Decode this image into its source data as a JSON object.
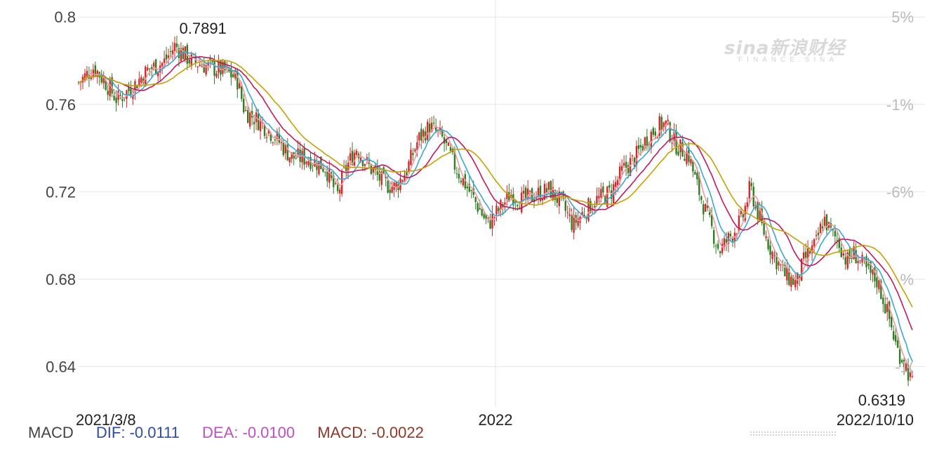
{
  "watermark": {
    "brand": "sina新浪财经",
    "sub": "FINANCE.SINA"
  },
  "indicator_bar": {
    "label": "MACD",
    "dif": "DIF: -0.0111",
    "dea": "DEA: -0.0100",
    "macd": "MACD: -0.0022"
  },
  "colors": {
    "up": "#d62728",
    "down": "#2e7d1e",
    "ma5": "#ee9aa6",
    "ma10": "#3aa6d8",
    "ma20": "#c2185b",
    "ma30": "#c8a000",
    "dif": "#2f4ca0",
    "dea": "#c050c0",
    "macd": "#8b3a2a"
  },
  "chart_data": {
    "type": "candlestick",
    "title": "",
    "ylim": [
      0.628,
      0.802
    ],
    "y_ticks": [
      "0.8",
      "0.76",
      "0.72",
      "0.68",
      "0.64"
    ],
    "y_tick_values": [
      0.8,
      0.76,
      0.72,
      0.68,
      0.64
    ],
    "right_ticks": [
      "5%",
      "-1%",
      "-6%",
      "%",
      "-1("
    ],
    "right_tick_values": [
      0.8,
      0.76,
      0.72,
      0.68,
      0.64
    ],
    "x_labels": [
      "2021/3/8",
      "2022",
      "2022/10/10"
    ],
    "x_label_positions": [
      0,
      0.5,
      1
    ],
    "annotations": {
      "high": "0.7891",
      "low": "0.6319"
    },
    "high": 0.7891,
    "low": 0.6319,
    "price_path": [
      {
        "t": 0.0,
        "v": 0.77
      },
      {
        "t": 0.02,
        "v": 0.777
      },
      {
        "t": 0.035,
        "v": 0.77
      },
      {
        "t": 0.05,
        "v": 0.762
      },
      {
        "t": 0.07,
        "v": 0.768
      },
      {
        "t": 0.09,
        "v": 0.776
      },
      {
        "t": 0.11,
        "v": 0.779
      },
      {
        "t": 0.125,
        "v": 0.787
      },
      {
        "t": 0.145,
        "v": 0.78
      },
      {
        "t": 0.17,
        "v": 0.777
      },
      {
        "t": 0.19,
        "v": 0.775
      },
      {
        "t": 0.205,
        "v": 0.772
      },
      {
        "t": 0.215,
        "v": 0.757
      },
      {
        "t": 0.235,
        "v": 0.752
      },
      {
        "t": 0.255,
        "v": 0.745
      },
      {
        "t": 0.275,
        "v": 0.736
      },
      {
        "t": 0.3,
        "v": 0.735
      },
      {
        "t": 0.32,
        "v": 0.731
      },
      {
        "t": 0.335,
        "v": 0.718
      },
      {
        "t": 0.345,
        "v": 0.73
      },
      {
        "t": 0.36,
        "v": 0.74
      },
      {
        "t": 0.375,
        "v": 0.732
      },
      {
        "t": 0.395,
        "v": 0.724
      },
      {
        "t": 0.41,
        "v": 0.722
      },
      {
        "t": 0.425,
        "v": 0.73
      },
      {
        "t": 0.44,
        "v": 0.744
      },
      {
        "t": 0.455,
        "v": 0.75
      },
      {
        "t": 0.47,
        "v": 0.745
      },
      {
        "t": 0.49,
        "v": 0.73
      },
      {
        "t": 0.51,
        "v": 0.718
      },
      {
        "t": 0.53,
        "v": 0.705
      },
      {
        "t": 0.545,
        "v": 0.712
      },
      {
        "t": 0.56,
        "v": 0.719
      },
      {
        "t": 0.575,
        "v": 0.716
      },
      {
        "t": 0.595,
        "v": 0.719
      },
      {
        "t": 0.61,
        "v": 0.721
      },
      {
        "t": 0.625,
        "v": 0.715
      },
      {
        "t": 0.64,
        "v": 0.705
      },
      {
        "t": 0.655,
        "v": 0.711
      },
      {
        "t": 0.67,
        "v": 0.716
      },
      {
        "t": 0.69,
        "v": 0.72
      },
      {
        "t": 0.705,
        "v": 0.73
      },
      {
        "t": 0.72,
        "v": 0.735
      },
      {
        "t": 0.735,
        "v": 0.744
      },
      {
        "t": 0.75,
        "v": 0.75
      },
      {
        "t": 0.76,
        "v": 0.751
      },
      {
        "t": 0.775,
        "v": 0.741
      },
      {
        "t": 0.79,
        "v": 0.737
      },
      {
        "t": 0.8,
        "v": 0.724
      },
      {
        "t": 0.815,
        "v": 0.708
      },
      {
        "t": 0.83,
        "v": 0.693
      },
      {
        "t": 0.845,
        "v": 0.7
      },
      {
        "t": 0.86,
        "v": 0.708
      },
      {
        "t": 0.87,
        "v": 0.722
      },
      {
        "t": 0.885,
        "v": 0.704
      },
      {
        "t": 0.9,
        "v": 0.691
      },
      {
        "t": 0.915,
        "v": 0.682
      },
      {
        "t": 0.93,
        "v": 0.678
      },
      {
        "t": 0.94,
        "v": 0.689
      },
      {
        "t": 0.955,
        "v": 0.696
      },
      {
        "t": 0.965,
        "v": 0.708
      },
      {
        "t": 0.975,
        "v": 0.701
      },
      {
        "t": 0.985,
        "v": 0.697
      },
      {
        "t": 0.995,
        "v": 0.688
      },
      {
        "t": 1.005,
        "v": 0.692
      },
      {
        "t": 1.02,
        "v": 0.684
      },
      {
        "t": 1.035,
        "v": 0.679
      },
      {
        "t": 1.05,
        "v": 0.662
      },
      {
        "t": 1.06,
        "v": 0.648
      },
      {
        "t": 1.07,
        "v": 0.642
      },
      {
        "t": 1.08,
        "v": 0.6319
      }
    ],
    "series": [
      {
        "name": "MA5",
        "window": 5
      },
      {
        "name": "MA10",
        "window": 10
      },
      {
        "name": "MA20",
        "window": 20
      },
      {
        "name": "MA30",
        "window": 30
      }
    ],
    "grid": true,
    "legend": "none"
  }
}
